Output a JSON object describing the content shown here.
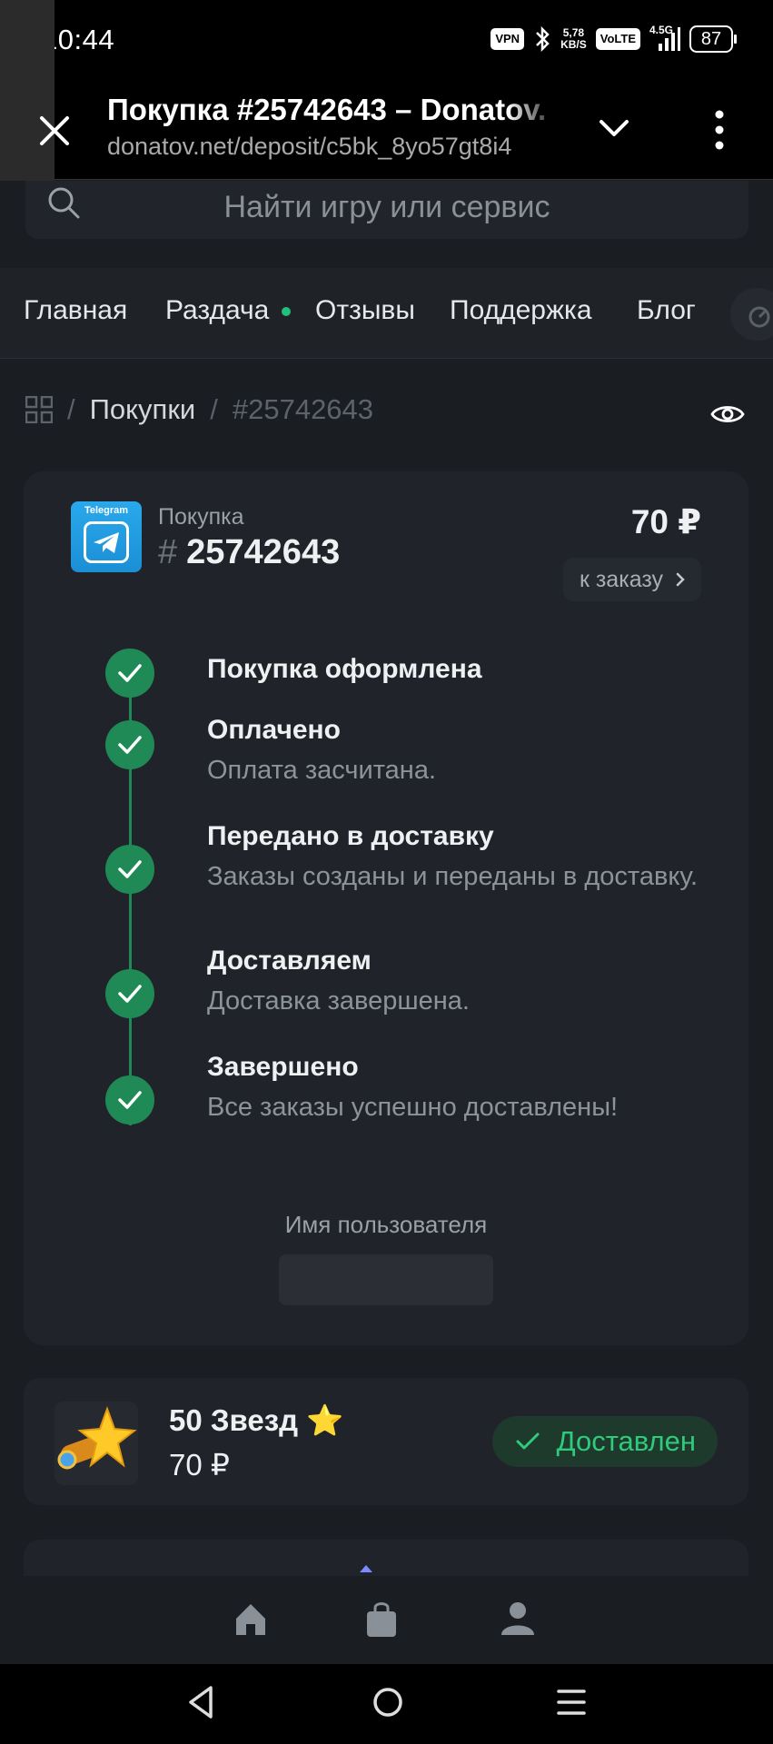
{
  "status_bar": {
    "time": "10:44",
    "vpn": "VPN",
    "speed_top": "5,78",
    "speed_bottom": "KB/S",
    "volte": "VoLTE",
    "network": "4.5G",
    "battery": "87"
  },
  "browser": {
    "title": "Покупка #25742643 – Donatov.",
    "url": "donatov.net/deposit/c5bk_8yo57gt8i4"
  },
  "search": {
    "placeholder": "Найти игру или сервис"
  },
  "nav": {
    "items": [
      "Главная",
      "Раздача",
      "Отзывы",
      "Поддержка",
      "Блог"
    ]
  },
  "breadcrumb": {
    "items": [
      "Покупки",
      "#25742643"
    ]
  },
  "purchase": {
    "logo_text": "Telegram",
    "label": "Покупка",
    "hash": "#",
    "number": "25742643",
    "price": "70 ₽",
    "to_order": "к заказу"
  },
  "steps": [
    {
      "title": "Покупка оформлена",
      "desc": ""
    },
    {
      "title": "Оплачено",
      "desc": "Оплата засчитана."
    },
    {
      "title": "Передано в доставку",
      "desc": "Заказы созданы и переданы в доставку."
    },
    {
      "title": "Доставляем",
      "desc": "Доставка завершена."
    },
    {
      "title": "Завершено",
      "desc": "Все заказы успешно доставлены!"
    }
  ],
  "username": {
    "label": "Имя пользователя",
    "value": ""
  },
  "order_item": {
    "name": "50 Звезд ⭐",
    "price": "70 ₽",
    "status": "Доставлен"
  },
  "colors": {
    "accent_green": "#1f8a56",
    "status_green": "#2ecb7b",
    "card_bg": "#20242a",
    "page_bg": "#1a1d22"
  }
}
